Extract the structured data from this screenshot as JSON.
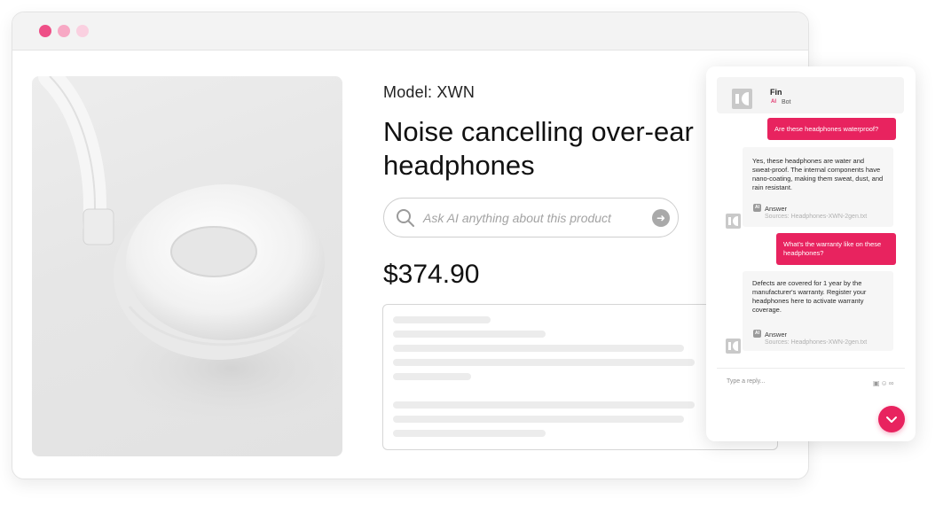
{
  "window": {
    "controls": [
      "close",
      "minimize",
      "maximize"
    ]
  },
  "product": {
    "model_label": "Model: XWN",
    "title": "Noise cancelling over-ear headphones",
    "price": "$374.90",
    "image_alt": "white headphones"
  },
  "search": {
    "placeholder": "Ask AI anything about this product"
  },
  "chat": {
    "bot_name": "Fin",
    "ai_badge": "AI",
    "bot_role": "Bot",
    "messages": [
      {
        "from": "user",
        "text": "Are these headphones waterproof?"
      },
      {
        "from": "bot",
        "text": "Yes, these headphones are water and sweat-proof. The internal components have nano-coating, making them sweat, dust, and rain resistant.",
        "answer_label": "Answer",
        "ai_badge": "AI",
        "sources": "Sources: Headphones-XWN-2gen.txt"
      },
      {
        "from": "user",
        "text": "What's the warranty like on these headphones?"
      },
      {
        "from": "bot",
        "text": "Defects are covered for 1 year by the manufacturer's warranty. Register your headphones here to activate warranty coverage.",
        "answer_label": "Answer",
        "ai_badge": "AI",
        "sources": "Sources: Headphones-XWN-2gen.txt"
      }
    ],
    "reply_placeholder": "Type a reply...",
    "reply_tools": [
      "gif-icon",
      "emoji-icon",
      "attachment-icon"
    ]
  },
  "colors": {
    "accent": "#e8235f",
    "dot_1": "#ee4f87",
    "dot_2": "#f7a8c4",
    "dot_3": "#fad0e0"
  }
}
